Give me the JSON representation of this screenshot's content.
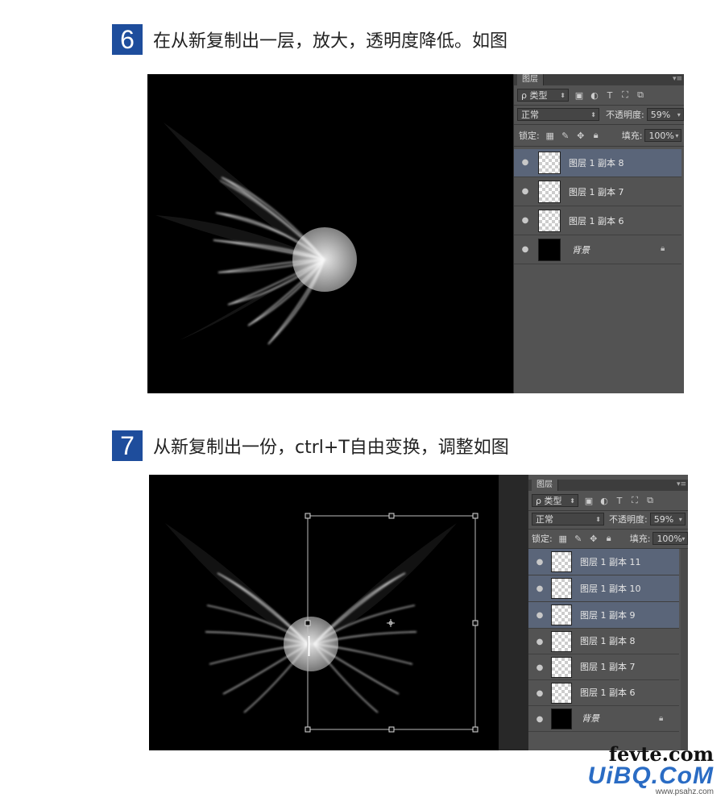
{
  "steps": [
    {
      "number": "6",
      "text": "在从新复制出一层，放大，透明度降低。如图",
      "panel": {
        "tab": "图层",
        "filter_label": "ρ 类型",
        "blend_mode": "正常",
        "opacity_label": "不透明度:",
        "opacity_value": "59%",
        "lock_label": "锁定:",
        "fill_label": "填充:",
        "fill_value": "100%",
        "layers": [
          {
            "name": "图层 1 副本 8",
            "selected": true,
            "thumb": "transparent"
          },
          {
            "name": "图层 1 副本 7",
            "selected": false,
            "thumb": "transparent"
          },
          {
            "name": "图层 1 副本 6",
            "selected": false,
            "thumb": "transparent"
          },
          {
            "name": "背景",
            "selected": false,
            "thumb": "black",
            "locked": true
          }
        ]
      }
    },
    {
      "number": "7",
      "text": "从新复制出一份，ctrl+T自由变换，调整如图",
      "panel": {
        "tab": "图层",
        "filter_label": "ρ 类型",
        "blend_mode": "正常",
        "opacity_label": "不透明度:",
        "opacity_value": "59%",
        "lock_label": "锁定:",
        "fill_label": "填充:",
        "fill_value": "100%",
        "layers": [
          {
            "name": "图层 1 副本 11",
            "selected": true,
            "thumb": "transparent"
          },
          {
            "name": "图层 1 副本 10",
            "selected": true,
            "thumb": "transparent"
          },
          {
            "name": "图层 1 副本 9",
            "selected": true,
            "thumb": "transparent"
          },
          {
            "name": "图层 1 副本 8",
            "selected": false,
            "thumb": "transparent"
          },
          {
            "name": "图层 1 副本 7",
            "selected": false,
            "thumb": "transparent"
          },
          {
            "name": "图层 1 副本 6",
            "selected": false,
            "thumb": "transparent"
          },
          {
            "name": "背景",
            "selected": false,
            "thumb": "black",
            "locked": true
          }
        ]
      }
    }
  ],
  "icons": {
    "eye": "eye-icon",
    "lock": "lock-icon",
    "panel_menu": "panel-menu-icon"
  },
  "watermark": {
    "line1": "fevte.com",
    "line2": "UiBQ.CoM",
    "line3": "www.psahz.com"
  },
  "colors": {
    "step_badge": "#1e4d9c",
    "panel_bg": "#535353",
    "selected_layer": "#5a6579"
  }
}
